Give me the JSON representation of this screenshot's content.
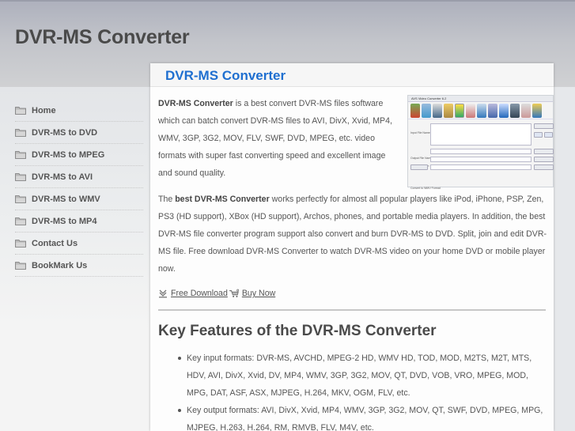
{
  "header": {
    "site_title": "DVR-MS Converter"
  },
  "sidebar": {
    "items": [
      {
        "label": "Home",
        "icon": "folder-icon"
      },
      {
        "label": "DVR-MS to DVD",
        "icon": "folder-icon"
      },
      {
        "label": "DVR-MS to MPEG",
        "icon": "folder-icon"
      },
      {
        "label": "DVR-MS to AVI",
        "icon": "folder-icon"
      },
      {
        "label": "DVR-MS to WMV",
        "icon": "folder-icon"
      },
      {
        "label": "DVR-MS to MP4",
        "icon": "folder-icon"
      },
      {
        "label": "Contact Us",
        "icon": "folder-icon"
      },
      {
        "label": "BookMark Us",
        "icon": "folder-icon"
      }
    ]
  },
  "main": {
    "title": "DVR-MS Converter",
    "intro": {
      "bold": "DVR-MS Converter",
      "text": " is a best convert DVR-MS files software which can batch convert DVR-MS files to AVI, DivX, Xvid, MP4, WMV, 3GP, 3G2, MOV, FLV, SWF, DVD, MPEG, etc. video formats with super fast converting speed and excellent image and sound quality."
    },
    "screenshot": {
      "app_title": "AVS Video Converter 6.2",
      "alt": "screenshot"
    },
    "paragraph2": {
      "prefix": "The ",
      "bold": "best DVR-MS Converter",
      "text": " works perfectly for almost all popular players like iPod, iPhone, PSP, Zen, PS3 (HD support), XBox (HD support), Archos, phones, and portable media players. In addition, the best DVR-MS file converter program support also convert and burn DVR-MS to DVD. Split, join and edit DVR-MS file. Free download DVR-MS Converter to watch DVR-MS video on your home DVD or mobile player now."
    },
    "links": {
      "free_download": "Free Download",
      "buy_now": "Buy Now"
    },
    "features_title": "Key Features of the DVR-MS Converter",
    "features": [
      "Key input formats: DVR-MS, AVCHD, MPEG-2 HD, WMV HD, TOD, MOD, M2TS, M2T, MTS, HDV, AVI, DivX, Xvid, DV, MP4, WMV, 3GP, 3G2, MOV, QT, DVD, VOB, VRO, MPEG, MOD, MPG, DAT, ASF, ASX, MJPEG, H.264, MKV, OGM, FLV, etc.",
      "Key output formats: AVI, DivX, Xvid, MP4, WMV, 3GP, 3G2, MOV, QT, SWF, DVD, MPEG, MPG, MJPEG, H.263, H.264, RM, RMVB, FLV, M4V, etc."
    ]
  },
  "colors": {
    "title_blue": "#1f6fd0",
    "text_gray": "#555555"
  }
}
